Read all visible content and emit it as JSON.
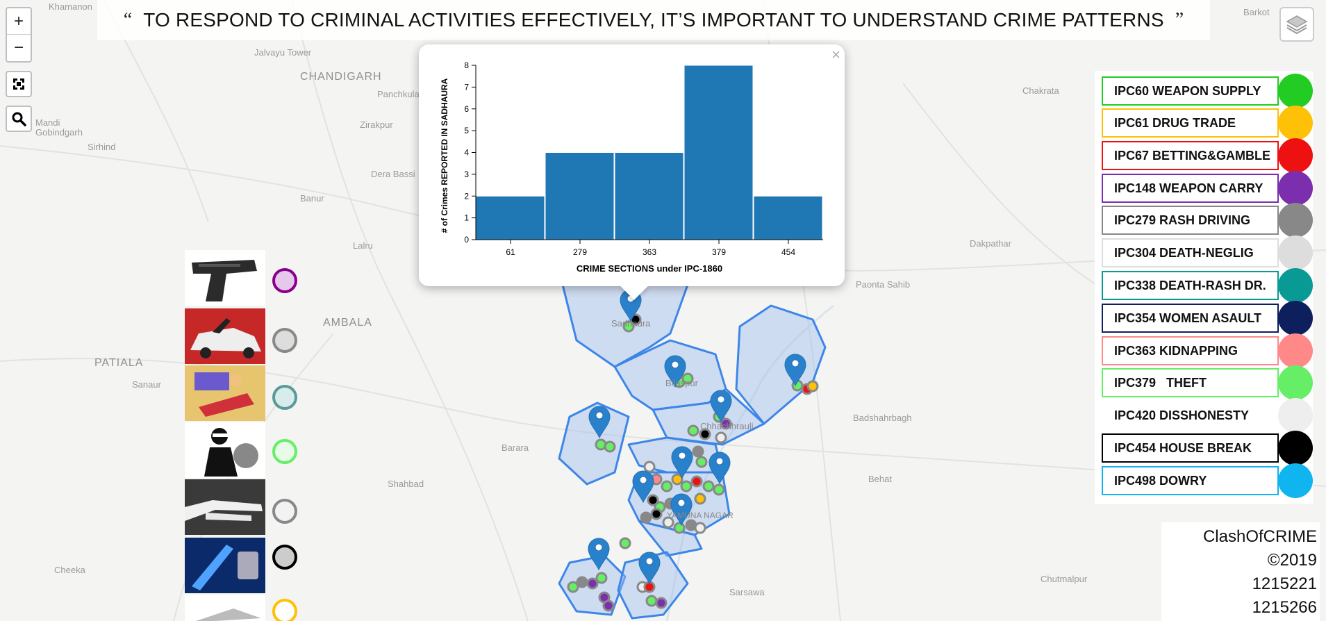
{
  "banner": {
    "open_quote": "“",
    "text": "TO RESPOND TO CRIMINAL ACTIVITIES EFFECTIVELY, IT’S IMPORTANT TO UNDERSTAND CRIME PATTERNS",
    "close_quote": "”"
  },
  "controls": {
    "zoom_in": "+",
    "zoom_out": "−"
  },
  "places": [
    {
      "name": "Khamanon",
      "big": false
    },
    {
      "name": "Jalvayu Tower",
      "big": false
    },
    {
      "name": "CHANDIGARH",
      "big": true
    },
    {
      "name": "Panchkula",
      "big": false
    },
    {
      "name": "Mandi Gobindgarh",
      "big": false
    },
    {
      "name": "Zirakpur",
      "big": false
    },
    {
      "name": "Sirhind",
      "big": false
    },
    {
      "name": "Dera Bassi",
      "big": false
    },
    {
      "name": "Banur",
      "big": false
    },
    {
      "name": "Lalru",
      "big": false
    },
    {
      "name": "AMBALA",
      "big": true
    },
    {
      "name": "PATIALA",
      "big": true
    },
    {
      "name": "Sanaur",
      "big": false
    },
    {
      "name": "Barara",
      "big": false
    },
    {
      "name": "Shahbad",
      "big": false
    },
    {
      "name": "Cheeka",
      "big": false
    },
    {
      "name": "Sarsawa",
      "big": false
    },
    {
      "name": "Behat",
      "big": false
    },
    {
      "name": "Badshahrbagh",
      "big": false
    },
    {
      "name": "Chutmalpur",
      "big": false
    },
    {
      "name": "Paonta Sahib",
      "big": false
    },
    {
      "name": "Dakpathar",
      "big": false
    },
    {
      "name": "Chakrata",
      "big": false
    },
    {
      "name": "Barkot",
      "big": false
    },
    {
      "name": "Sadhaura",
      "big": false
    },
    {
      "name": "Bilaspur",
      "big": false
    },
    {
      "name": "Chhachhrauli",
      "big": false
    },
    {
      "name": "YAMUNA NAGAR",
      "big": false
    }
  ],
  "popup": {
    "close": "×"
  },
  "chart_data": {
    "type": "bar",
    "categories": [
      "61",
      "279",
      "363",
      "379",
      "454"
    ],
    "values": [
      2,
      4,
      4,
      8,
      2
    ],
    "title": "",
    "xlabel": "CRIME SECTIONS under IPC-1860",
    "ylabel": "# of Crimes REPORTED IN SADHAURA",
    "ylim": [
      0,
      8
    ],
    "yticks": [
      "0",
      "1",
      "2",
      "3",
      "4",
      "5",
      "6",
      "7",
      "8"
    ],
    "bar_color": "#1f77b4",
    "grid": false
  },
  "legend": [
    {
      "label": "IPC60 WEAPON SUPPLY",
      "color": "#22cc22"
    },
    {
      "label": "IPC61 DRUG TRADE",
      "color": "#ffc107"
    },
    {
      "label": "IPC67 BETTING&GAMBLE",
      "color": "#ee1111"
    },
    {
      "label": "IPC148 WEAPON CARRY",
      "color": "#7b2fae"
    },
    {
      "label": "IPC279 RASH DRIVING",
      "color": "#888888"
    },
    {
      "label": "IPC304 DEATH-NEGLIG",
      "color": "#dddddd"
    },
    {
      "label": "IPC338 DEATH-RASH DR.",
      "color": "#0a9a96"
    },
    {
      "label": "IPC354 WOMEN ASAULT",
      "color": "#0d1f5c"
    },
    {
      "label": "IPC363 KIDNAPPING",
      "color": "#ff8888"
    },
    {
      "label": "IPC379   THEFT",
      "color": "#66ee66"
    },
    {
      "label": "IPC420 DISSHONESTY",
      "color": "#eeeeee"
    },
    {
      "label": "IPC454 HOUSE BREAK",
      "color": "#000000"
    },
    {
      "label": "IPC498 DOWRY",
      "color": "#10b4ee"
    }
  ],
  "credits": [
    "ClashOfCRIME",
    "©2019",
    "1215221",
    "1215266"
  ],
  "crime_images": [
    {
      "icon": "pistol-image",
      "ring_color": "#8a008a",
      "ring_fill": "#e6c8ec"
    },
    {
      "icon": "car-crash-image",
      "ring_color": "#888888",
      "ring_fill": "#dddddd"
    },
    {
      "icon": "accident-image",
      "ring_color": "#5a9a9a",
      "ring_fill": "#d8ecec"
    },
    {
      "icon": "thief-image",
      "ring_color": "#66ee66",
      "ring_fill": "#e8fbe8"
    },
    {
      "icon": "hand-image",
      "ring_color": "#888888",
      "ring_fill": "#f2f2f2"
    },
    {
      "icon": "lock-break-image",
      "ring_color": "#000000",
      "ring_fill": "#cccccc"
    },
    {
      "icon": "cash-drugs-image",
      "ring_color": "#ffc107",
      "ring_fill": "#fff"
    }
  ]
}
